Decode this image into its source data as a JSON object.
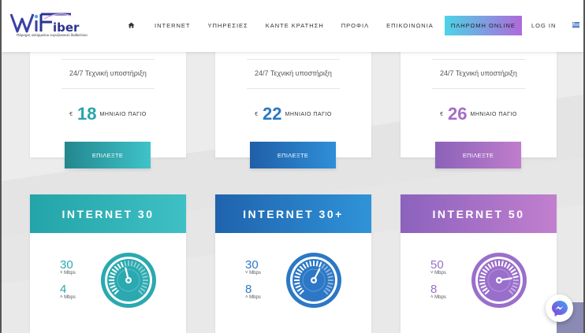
{
  "brand": {
    "logo_text": "WiFiber",
    "tagline": "Πάροχος ασύρματου ευρυζωνικού διαδικτύου"
  },
  "nav": {
    "home_icon": "home-icon",
    "items": [
      "INTERNET",
      "ΥΠΗΡΕΣΙΕΣ",
      "ΚΑΝΤΕ ΚΡΑΤΗΣΗ",
      "ΠΡΟΦΙΛ",
      "ΕΠΙΚΟΙΝΩΝΙΑ"
    ],
    "pay_button": "ΠΛΗΡΩΜΗ ONLINE",
    "login": "LOG IN",
    "language_icon": "greek-flag-icon"
  },
  "top_plans": [
    {
      "support": "24/7 Τεχνική υποστήριξη",
      "currency": "€",
      "price": "18",
      "period": "ΜΗΝΙΑΙΟ ΠΑΓΙΟ",
      "button": "ΕΠΙΛΕΞΤΕ",
      "color": "#27a3ad"
    },
    {
      "support": "24/7 Τεχνική υποστήριξη",
      "currency": "€",
      "price": "22",
      "period": "ΜΗΝΙΑΙΟ ΠΑΓΙΟ",
      "button": "ΕΠΙΛΕΞΤΕ",
      "color": "#2a78c4"
    },
    {
      "support": "24/7 Τεχνική υποστήριξη",
      "currency": "€",
      "price": "26",
      "period": "ΜΗΝΙΑΙΟ ΠΑΓΙΟ",
      "button": "ΕΠΙΛΕΞΤΕ",
      "color": "#a76cc4"
    }
  ],
  "bottom_plans": [
    {
      "title": "INTERNET 30",
      "down": "30",
      "down_unit": "Mbps",
      "up": "4",
      "up_unit": "Mbps",
      "color": "#2aa9b0",
      "gauge_level": 0.45
    },
    {
      "title": "INTERNET 30+",
      "down": "30",
      "down_unit": "Mbps",
      "up": "8",
      "up_unit": "Mbps",
      "color": "#2c78c6",
      "gauge_level": 0.6
    },
    {
      "title": "INTERNET 50",
      "down": "50",
      "down_unit": "Mbps",
      "up": "8",
      "up_unit": "Mbps",
      "color": "#9a6fcb",
      "gauge_level": 0.8
    }
  ],
  "widgets": {
    "messenger_icon": "messenger-icon",
    "scroll_top_icon": "scroll-top-icon"
  }
}
